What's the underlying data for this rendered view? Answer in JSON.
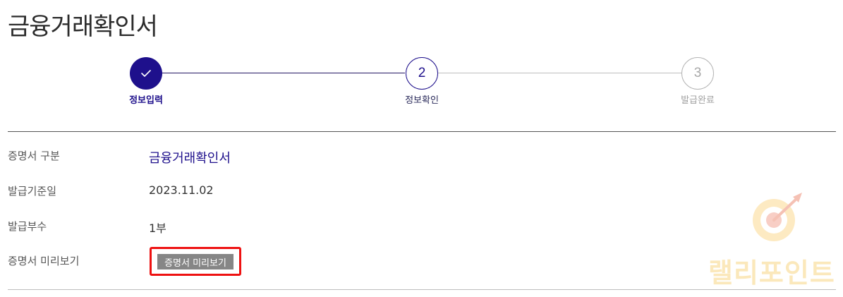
{
  "page": {
    "title": "금융거래확인서"
  },
  "stepper": {
    "steps": [
      {
        "number": "",
        "label": "정보입력",
        "state": "done"
      },
      {
        "number": "2",
        "label": "정보확인",
        "state": "current"
      },
      {
        "number": "3",
        "label": "발급완료",
        "state": "pending"
      }
    ]
  },
  "details": {
    "type_label": "증명서 구분",
    "type_value": "금융거래확인서",
    "date_label": "발급기준일",
    "date_value": "2023.11.02",
    "copies_label": "발급부수",
    "copies_value": "1부",
    "preview_label": "증명서 미리보기",
    "preview_button": "증명서 미리보기"
  },
  "watermark": {
    "text": "랠리포인트"
  },
  "colors": {
    "primary": "#1e108c",
    "highlight": "#ee1111",
    "button": "#868686",
    "watermark": "#fbe5b0"
  },
  "icons": {
    "step1": "check-icon",
    "watermark": "target-arrow-icon"
  }
}
